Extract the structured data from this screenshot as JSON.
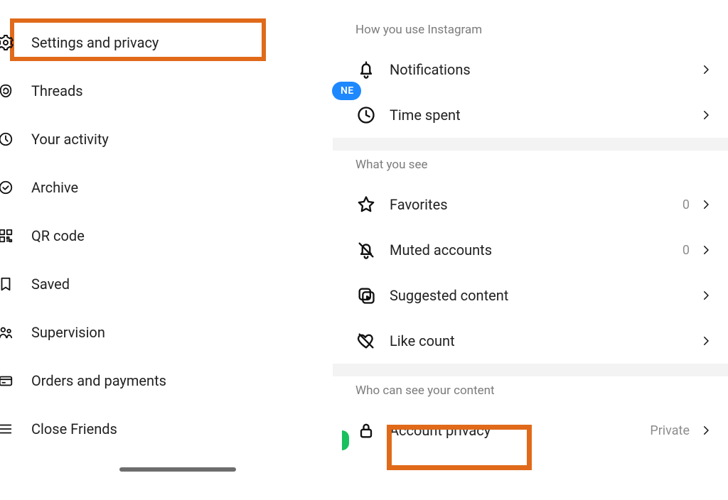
{
  "leftMenu": {
    "items": [
      {
        "label": "Settings and privacy",
        "highlighted": true
      },
      {
        "label": "Threads",
        "badge": "NE"
      },
      {
        "label": "Your activity"
      },
      {
        "label": "Archive"
      },
      {
        "label": "QR code"
      },
      {
        "label": "Saved"
      },
      {
        "label": "Supervision"
      },
      {
        "label": "Orders and payments"
      },
      {
        "label": "Close Friends"
      }
    ]
  },
  "settings": {
    "sections": [
      {
        "header": "How you use Instagram",
        "rows": [
          {
            "label": "Notifications"
          },
          {
            "label": "Time spent"
          }
        ]
      },
      {
        "header": "What you see",
        "rows": [
          {
            "label": "Favorites",
            "value": "0"
          },
          {
            "label": "Muted accounts",
            "value": "0"
          },
          {
            "label": "Suggested content"
          },
          {
            "label": "Like count"
          }
        ]
      },
      {
        "header": "Who can see your content",
        "rows": [
          {
            "label": "Account privacy",
            "value": "Private",
            "highlighted": true
          }
        ]
      }
    ]
  },
  "colors": {
    "highlight": "#e06a1a",
    "badgeBlue": "#1e88ff",
    "badgeGreen": "#19c05d"
  }
}
